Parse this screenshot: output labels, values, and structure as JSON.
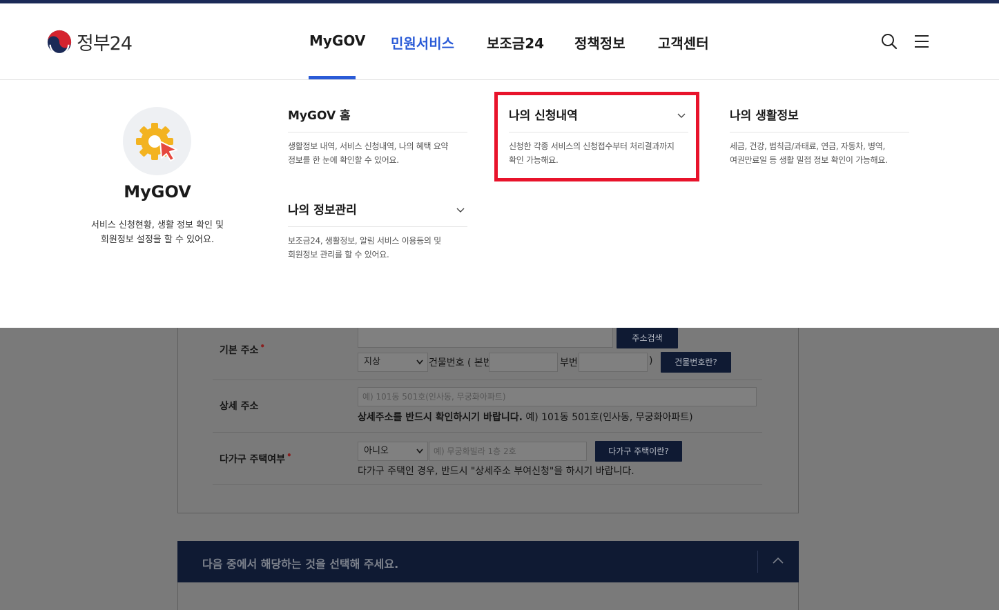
{
  "header": {
    "logo_text": "정부24",
    "nav": [
      {
        "label": "MyGOV",
        "active": false
      },
      {
        "label": "민원서비스",
        "active": true
      },
      {
        "label": "보조금24",
        "active": false
      },
      {
        "label": "정책정보",
        "active": false
      },
      {
        "label": "고객센터",
        "active": false
      }
    ],
    "icons": [
      "search-icon",
      "menu-icon"
    ],
    "colors": {
      "accent": "#2a5bd7",
      "brand_navy": "#1b2a57"
    }
  },
  "mega_menu": {
    "hero": {
      "title": "MyGOV",
      "description_line1": "서비스 신청현황, 생활 정보 확인 및",
      "description_line2": "회원정보 설정을 할 수 있어요."
    },
    "items": [
      {
        "title": "MyGOV 홈",
        "desc_line1": "생활정보 내역, 서비스 신청내역, 나의 혜택 요약",
        "desc_line2": "정보를 한 눈에 확인할 수 있어요.",
        "has_chevron": false
      },
      {
        "title": "나의 정보관리",
        "desc_line1": "보조금24, 생활정보, 알림 서비스 이용등의 및",
        "desc_line2": "회원정보 관리를 할 수 있어요.",
        "has_chevron": true
      },
      {
        "title": "나의 신청내역",
        "desc_line1": "신청한 각종 서비스의 신청접수부터 처리결과까지",
        "desc_line2": "확인 가능해요.",
        "has_chevron": true,
        "highlighted": true
      },
      {
        "title": "나의 생활정보",
        "desc_line1": "세금, 건강, 범칙금/과태료, 연금, 자동차, 병역,",
        "desc_line2": "여권만료일 등 생활 밀접 정보 확인이 가능해요.",
        "has_chevron": false
      }
    ],
    "highlight_color": "#e8132b"
  },
  "form": {
    "basic_address": {
      "label": "기본 주소",
      "required_mark": "•",
      "search_button": "주소검색",
      "ground_select": "지상",
      "building_no_label": "건물번호 ( 본번",
      "sub_no_label": "부번",
      "close_paren": ")",
      "building_help_button": "건물번호란?"
    },
    "detail_address": {
      "label": "상세 주소",
      "placeholder": "예) 101동 501호(인사동, 무궁화아파트)",
      "notice_bold": "상세주소를 반드시 확인하시기 바랍니다.",
      "notice_rest": " 예) 101동 501호(인사동, 무궁화아파트)"
    },
    "multi_household": {
      "label": "다가구 주택여부",
      "required_mark": "•",
      "select_value": "아니오",
      "placeholder": "예) 무궁화빌라 1층 2호",
      "help_button": "다가구 주택이란?",
      "notice": "다가구 주택인 경우, 반드시 \"상세주소 부여신청\"을 하시기 바랍니다."
    }
  },
  "section": {
    "title": "다음 중에서 해당하는 것을 선택해 주세요."
  }
}
